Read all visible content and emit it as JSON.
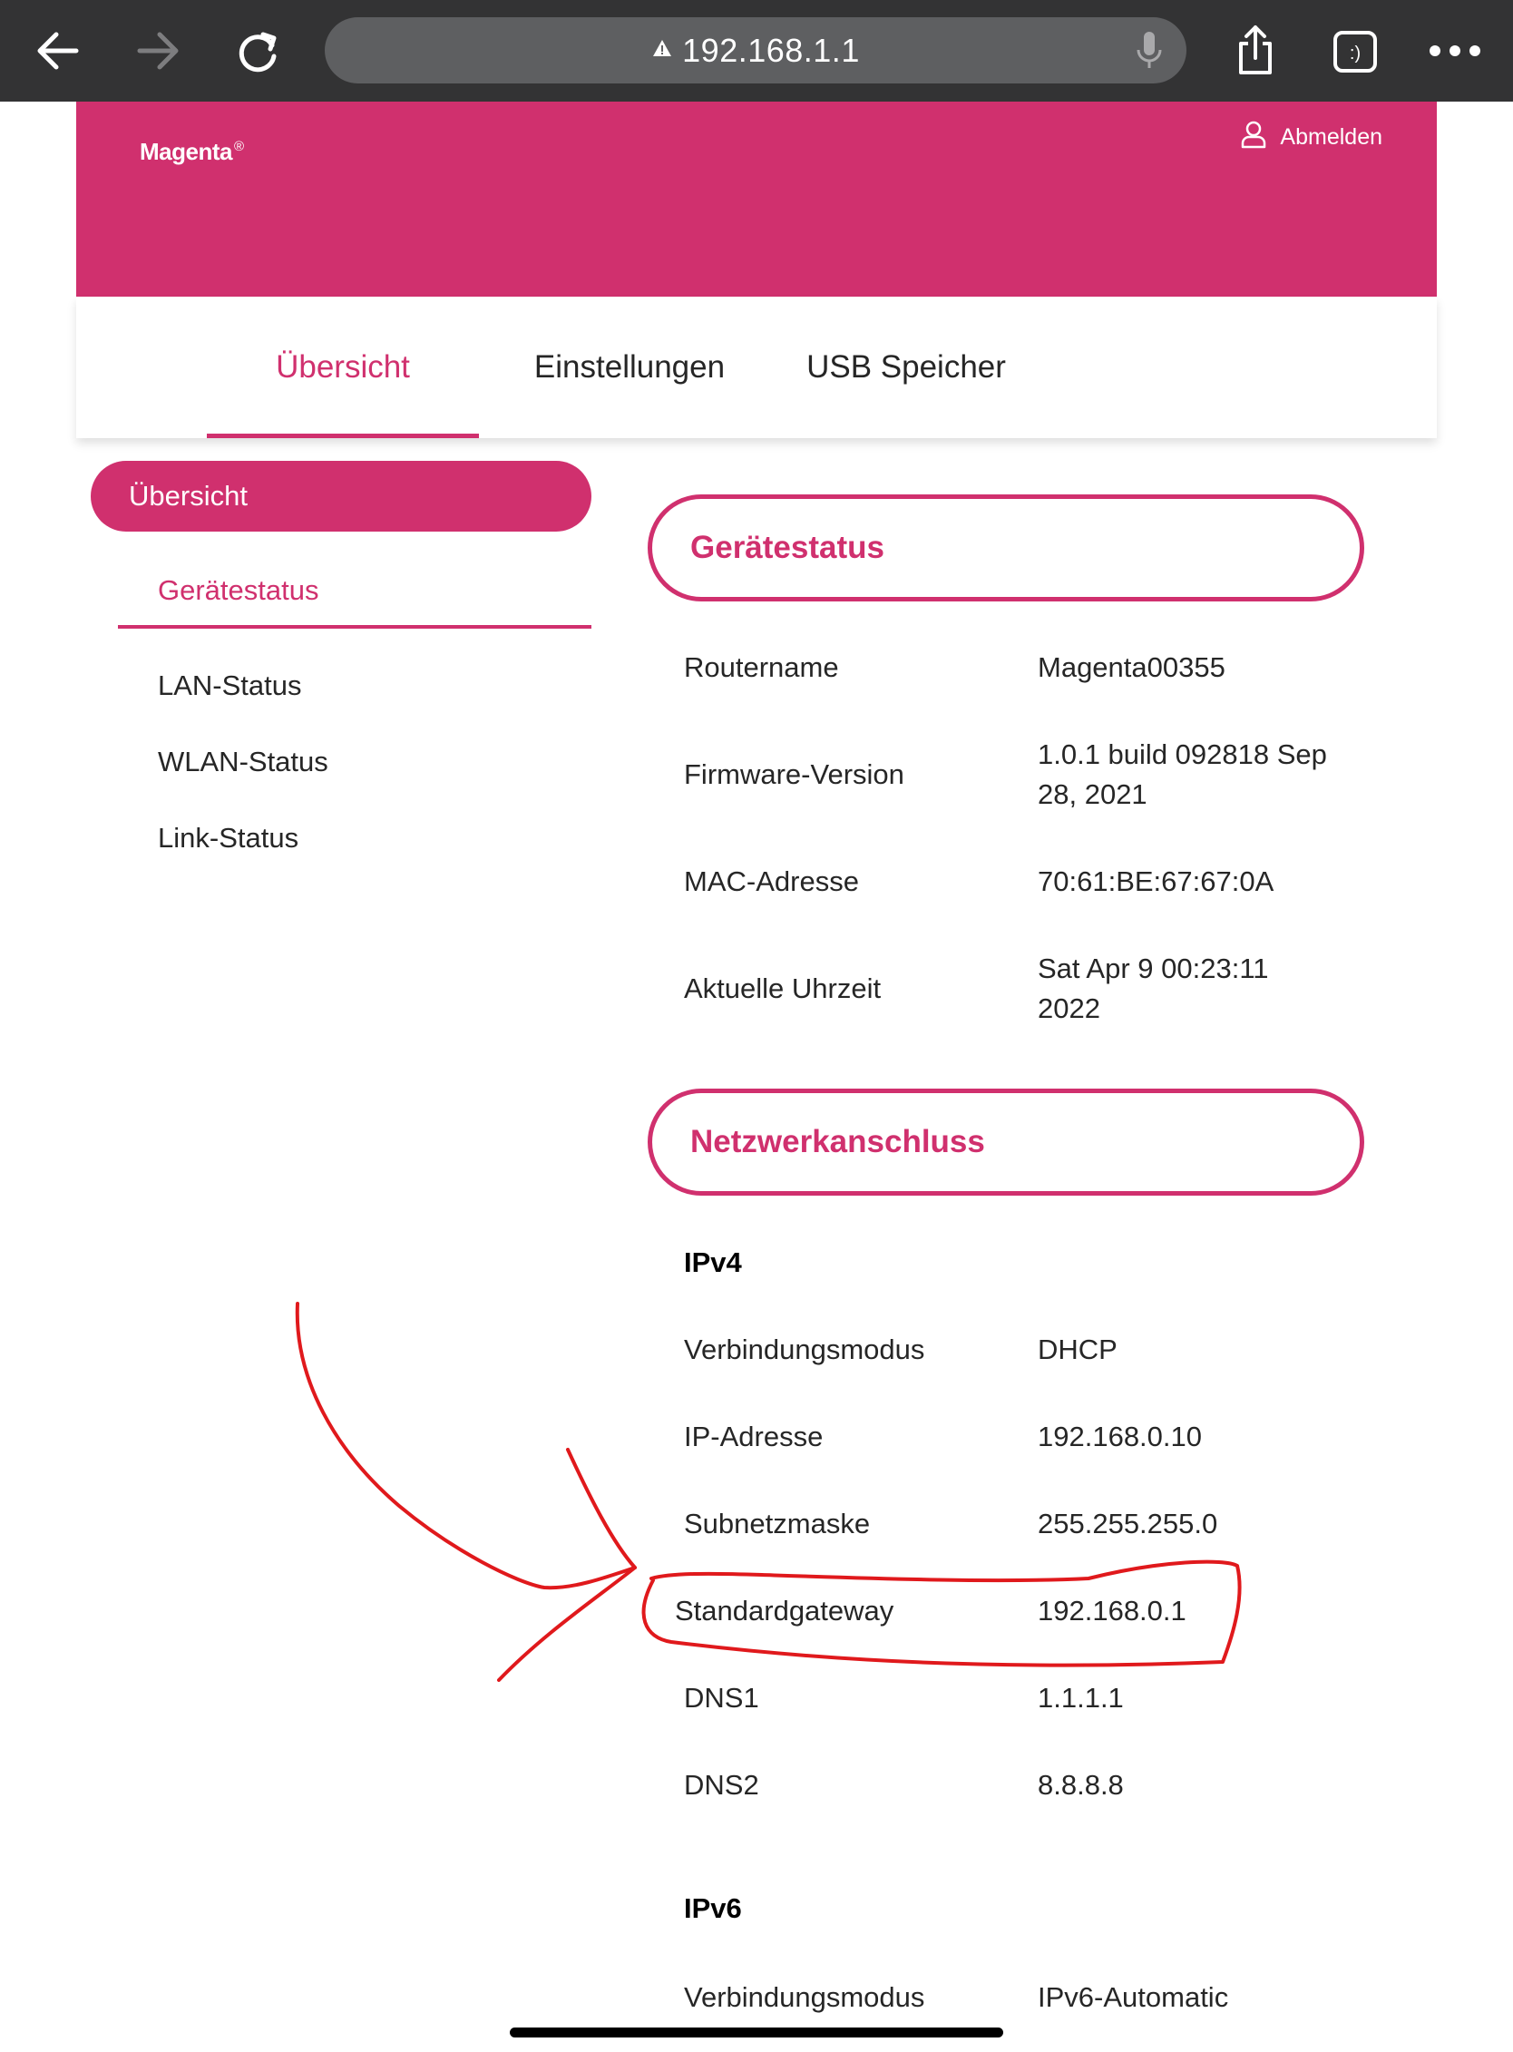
{
  "browser": {
    "url": "192.168.1.1",
    "icons": [
      "back-arrow-icon",
      "forward-arrow-icon",
      "reload-icon",
      "warning-triangle-icon",
      "microphone-icon",
      "share-icon",
      "tabs-icon",
      "more-icon"
    ],
    "tabs_icon_text": ":)"
  },
  "header": {
    "logo_text": "Magenta",
    "logo_mark": "®",
    "logout_label": "Abmelden",
    "color": "#d0306e"
  },
  "tabs": [
    {
      "label": "Übersicht",
      "active": true
    },
    {
      "label": "Einstellungen",
      "active": false
    },
    {
      "label": "USB Speicher",
      "active": false
    }
  ],
  "sidebar": {
    "group_label": "Übersicht",
    "items": [
      {
        "label": "Gerätestatus",
        "active": true
      },
      {
        "label": "LAN-Status",
        "active": false
      },
      {
        "label": "WLAN-Status",
        "active": false
      },
      {
        "label": "Link-Status",
        "active": false
      }
    ]
  },
  "device_status": {
    "title": "Gerätestatus",
    "rows": [
      {
        "label": "Routername",
        "value_lines": [
          "Magenta00355"
        ]
      },
      {
        "label": "Firmware-Version",
        "value_lines": [
          "1.0.1 build 092818 Sep",
          "28, 2021"
        ]
      },
      {
        "label": "MAC-Adresse",
        "value_lines": [
          "70:61:BE:67:67:0A"
        ]
      },
      {
        "label": "Aktuelle Uhrzeit",
        "value_lines": [
          "Sat Apr 9 00:23:11",
          "2022"
        ]
      }
    ]
  },
  "network": {
    "title": "Netzwerkanschluss",
    "ipv4": {
      "heading": "IPv4",
      "rows": [
        {
          "label": "Verbindungsmodus",
          "value": "DHCP"
        },
        {
          "label": "IP-Adresse",
          "value": "192.168.0.10"
        },
        {
          "label": "Subnetzmaske",
          "value": "255.255.255.0"
        },
        {
          "label": "Standardgateway",
          "value": "192.168.0.1",
          "highlighted": true
        },
        {
          "label": "DNS1",
          "value": "1.1.1.1"
        },
        {
          "label": "DNS2",
          "value": "8.8.8.8"
        }
      ]
    },
    "ipv6": {
      "heading": "IPv6",
      "rows": [
        {
          "label": "Verbindungsmodus",
          "value": "IPv6-Automatic"
        }
      ]
    }
  },
  "annotation_color": "#e0191c"
}
